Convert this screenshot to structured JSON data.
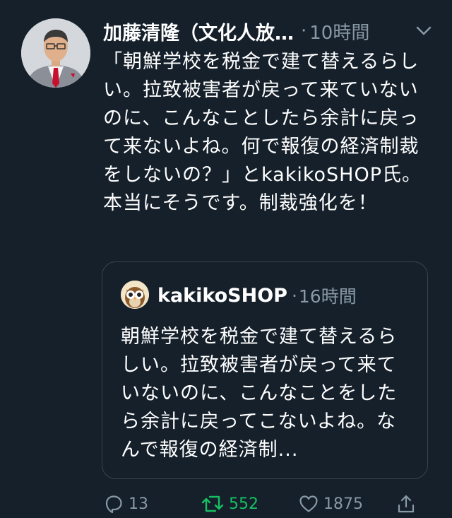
{
  "tweet": {
    "author_name": "加藤清隆（文化人放…",
    "time": "10時間",
    "separator": "·",
    "text": "「朝鮮学校を税金で建て替えるらしい。拉致被害者が戻って来ていないのに、こんなことしたら余計に戻って来ないよね。何で報復の経済制裁をしないの？」とkakikoSHOP氏。本当にそうです。制裁強化を！"
  },
  "quote": {
    "author_name": "kakikoSHOP",
    "time": "16時間",
    "separator": "·",
    "text": "朝鮮学校を税金で建て替えるらしい。拉致被害者が戻って来ていないのに、こんなことをしたら余計に戻ってこないよね。なんで報復の経済制..."
  },
  "actions": {
    "reply_count": "13",
    "retweet_count": "552",
    "like_count": "1875"
  },
  "icons": {
    "menu": "chevron-down-icon",
    "reply": "reply-icon",
    "retweet": "retweet-icon",
    "like": "heart-icon",
    "share": "share-icon"
  },
  "colors": {
    "background": "#15202b",
    "secondary_text": "#8899a6",
    "retweet_active": "#17bf63",
    "border": "#38444d"
  }
}
